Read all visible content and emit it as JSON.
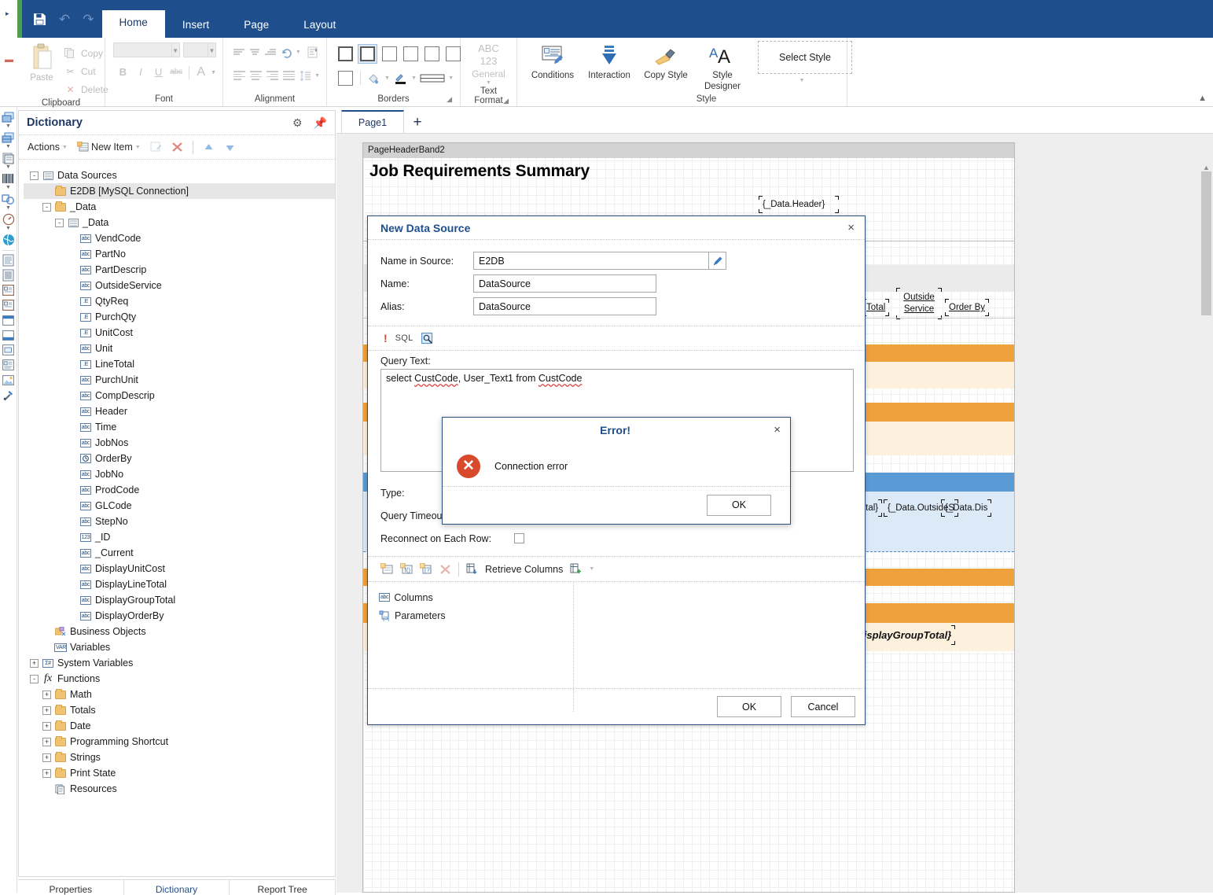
{
  "titlebar": {
    "quick_access": [
      {
        "name": "save-icon",
        "label": "Save"
      },
      {
        "name": "undo-icon",
        "label": "Undo"
      },
      {
        "name": "redo-icon",
        "label": "Redo"
      }
    ],
    "tabs": [
      {
        "label": "Home",
        "active": true
      },
      {
        "label": "Insert",
        "active": false
      },
      {
        "label": "Page",
        "active": false
      },
      {
        "label": "Layout",
        "active": false
      }
    ]
  },
  "ribbon": {
    "clipboard": {
      "group_label": "Clipboard",
      "paste": "Paste",
      "copy": "Copy",
      "cut": "Cut",
      "delete": "Delete"
    },
    "font": {
      "group_label": "Font",
      "font_name": "",
      "font_size": "",
      "bold": "B",
      "italic": "I",
      "underline": "U",
      "strike": "abc",
      "color": "A"
    },
    "alignment": {
      "group_label": "Alignment"
    },
    "borders": {
      "group_label": "Borders"
    },
    "text_format": {
      "group_label": "Text Format",
      "line1": "ABC",
      "line2": "123",
      "line3": "General"
    },
    "style": {
      "group_label": "Style",
      "buttons": [
        {
          "label": "Conditions",
          "icon": "conditions-icon"
        },
        {
          "label": "Interaction",
          "icon": "interaction-icon"
        },
        {
          "label": "Copy Style",
          "icon": "copy-style-icon"
        },
        {
          "label": "Style Designer",
          "icon": "style-designer-icon"
        }
      ],
      "select_style": "Select Style"
    }
  },
  "dictionary": {
    "title": "Dictionary",
    "toolbar": {
      "actions": "Actions",
      "new_item": "New Item"
    },
    "tree": [
      {
        "label": "Data Sources",
        "indent": 0,
        "expander": "-",
        "icon": "grid-icon",
        "selected": false
      },
      {
        "label": "E2DB [MySQL Connection]",
        "indent": 1,
        "expander": "",
        "icon": "folder-icon",
        "selected": true
      },
      {
        "label": "_Data",
        "indent": 1,
        "expander": "-",
        "icon": "folder-icon",
        "selected": false
      },
      {
        "label": "_Data",
        "indent": 2,
        "expander": "-",
        "icon": "grid-icon",
        "selected": false
      },
      {
        "label": "VendCode",
        "indent": 3,
        "expander": "",
        "icon": "abc",
        "selected": false
      },
      {
        "label": "PartNo",
        "indent": 3,
        "expander": "",
        "icon": "abc",
        "selected": false
      },
      {
        "label": "PartDescrip",
        "indent": 3,
        "expander": "",
        "icon": "abc",
        "selected": false
      },
      {
        "label": "OutsideService",
        "indent": 3,
        "expander": "",
        "icon": "abc",
        "selected": false
      },
      {
        "label": "QtyReq",
        "indent": 3,
        "expander": "",
        "icon": "dote",
        "selected": false
      },
      {
        "label": "PurchQty",
        "indent": 3,
        "expander": "",
        "icon": "dote",
        "selected": false
      },
      {
        "label": "UnitCost",
        "indent": 3,
        "expander": "",
        "icon": "dote",
        "selected": false
      },
      {
        "label": "Unit",
        "indent": 3,
        "expander": "",
        "icon": "abc",
        "selected": false
      },
      {
        "label": "LineTotal",
        "indent": 3,
        "expander": "",
        "icon": "dote",
        "selected": false
      },
      {
        "label": "PurchUnit",
        "indent": 3,
        "expander": "",
        "icon": "abc",
        "selected": false
      },
      {
        "label": "CompDescrip",
        "indent": 3,
        "expander": "",
        "icon": "abc",
        "selected": false
      },
      {
        "label": "Header",
        "indent": 3,
        "expander": "",
        "icon": "abc",
        "selected": false
      },
      {
        "label": "Time",
        "indent": 3,
        "expander": "",
        "icon": "abc",
        "selected": false
      },
      {
        "label": "JobNos",
        "indent": 3,
        "expander": "",
        "icon": "abc",
        "selected": false
      },
      {
        "label": "OrderBy",
        "indent": 3,
        "expander": "",
        "icon": "clock",
        "selected": false
      },
      {
        "label": "JobNo",
        "indent": 3,
        "expander": "",
        "icon": "abc",
        "selected": false
      },
      {
        "label": "ProdCode",
        "indent": 3,
        "expander": "",
        "icon": "abc",
        "selected": false
      },
      {
        "label": "GLCode",
        "indent": 3,
        "expander": "",
        "icon": "abc",
        "selected": false
      },
      {
        "label": "StepNo",
        "indent": 3,
        "expander": "",
        "icon": "abc",
        "selected": false
      },
      {
        "label": "_ID",
        "indent": 3,
        "expander": "",
        "icon": "123",
        "selected": false
      },
      {
        "label": "_Current",
        "indent": 3,
        "expander": "",
        "icon": "abc",
        "selected": false
      },
      {
        "label": "DisplayUnitCost",
        "indent": 3,
        "expander": "",
        "icon": "abc",
        "selected": false
      },
      {
        "label": "DisplayLineTotal",
        "indent": 3,
        "expander": "",
        "icon": "abc",
        "selected": false
      },
      {
        "label": "DisplayGroupTotal",
        "indent": 3,
        "expander": "",
        "icon": "abc",
        "selected": false
      },
      {
        "label": "DisplayOrderBy",
        "indent": 3,
        "expander": "",
        "icon": "abc",
        "selected": false
      },
      {
        "label": "Business Objects",
        "indent": 1,
        "expander": "",
        "icon": "bizobj",
        "selected": false
      },
      {
        "label": "Variables",
        "indent": 1,
        "expander": "",
        "icon": "var",
        "selected": false
      },
      {
        "label": "System Variables",
        "indent": 0,
        "expander": "+",
        "icon": "sysvar",
        "selected": false
      },
      {
        "label": "Functions",
        "indent": 0,
        "expander": "-",
        "icon": "fx",
        "selected": false
      },
      {
        "label": "Math",
        "indent": 1,
        "expander": "+",
        "icon": "folder-icon",
        "selected": false
      },
      {
        "label": "Totals",
        "indent": 1,
        "expander": "+",
        "icon": "folder-icon",
        "selected": false
      },
      {
        "label": "Date",
        "indent": 1,
        "expander": "+",
        "icon": "folder-icon",
        "selected": false
      },
      {
        "label": "Programming Shortcut",
        "indent": 1,
        "expander": "+",
        "icon": "folder-icon",
        "selected": false
      },
      {
        "label": "Strings",
        "indent": 1,
        "expander": "+",
        "icon": "folder-icon",
        "selected": false
      },
      {
        "label": "Print State",
        "indent": 1,
        "expander": "+",
        "icon": "folder-icon",
        "selected": false
      },
      {
        "label": "Resources",
        "indent": 1,
        "expander": "",
        "icon": "resources",
        "selected": false
      }
    ],
    "bottom_tabs": [
      {
        "label": "Properties",
        "active": false
      },
      {
        "label": "Dictionary",
        "active": true
      },
      {
        "label": "Report Tree",
        "active": false
      }
    ]
  },
  "designer": {
    "page_tab": "Page1",
    "add_tab": "+",
    "band_label": "PageHeaderBand2",
    "report_title": "Job Requirements Summary",
    "components": [
      {
        "text": "{_Data.Header}",
        "name": "data-header-textbox"
      },
      {
        "text": "Total",
        "name": "total-header-textbox"
      },
      {
        "text": "Outside Service",
        "name": "outside-service-header-textbox"
      },
      {
        "text": "Order By",
        "name": "order-by-header-textbox"
      },
      {
        "text": "Total}",
        "name": "total-value-textbox"
      },
      {
        "text": "{_Data.OutsideS",
        "name": "outside-service-value-textbox"
      },
      {
        "text": "{_Data.Dis",
        "name": "display-order-value-textbox"
      },
      {
        "text": "ata.DisplayGroupTotal}",
        "name": "group-total-textbox"
      }
    ]
  },
  "new_data_source": {
    "title": "New Data Source",
    "close": "×",
    "name_in_source_label": "Name in Source:",
    "name_in_source_value": "E2DB",
    "name_label": "Name:",
    "name_value": "DataSource",
    "alias_label": "Alias:",
    "alias_value": "DataSource",
    "sql_tag": "SQL",
    "query_text_label": "Query Text:",
    "query_text": "select CustCode, User_Text1 from CustCode",
    "query_tokens": [
      {
        "t": "select ",
        "squiggly": false
      },
      {
        "t": "CustCode",
        "squiggly": true
      },
      {
        "t": ", User_Text1 from ",
        "squiggly": false
      },
      {
        "t": "CustCode",
        "squiggly": true
      }
    ],
    "type_label": "Type:",
    "query_timeout_label": "Query Timeout",
    "reconnect_label": "Reconnect on Each Row:",
    "retrieve_columns": "Retrieve Columns",
    "tree": [
      {
        "label": "Columns",
        "icon": "abc"
      },
      {
        "label": "Parameters",
        "icon": "param"
      }
    ],
    "ok": "OK",
    "cancel": "Cancel"
  },
  "error_dialog": {
    "title": "Error!",
    "close": "×",
    "message": "Connection error",
    "ok": "OK",
    "icon_color": "#d9492c"
  },
  "colors": {
    "titlebar": "#1f4e8c",
    "accent": "#1f4e8c",
    "band_orange": "#efa13b",
    "band_light_orange": "#fdf0dc",
    "band_blue": "#5b9bd5",
    "band_light_blue": "#dce9f7",
    "error_red": "#d9492c"
  }
}
